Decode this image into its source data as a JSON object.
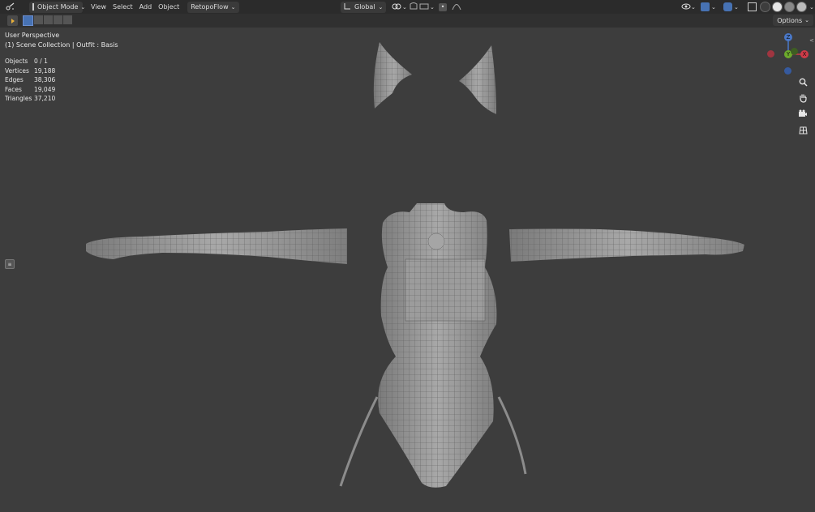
{
  "header": {
    "mode": "Object Mode",
    "menus": [
      "View",
      "Select",
      "Add",
      "Object"
    ],
    "addon": "RetopoFlow",
    "orientation": "Global"
  },
  "options_label": "Options",
  "viewport": {
    "perspective": "User Perspective",
    "collection": "(1) Scene Collection | Outfit : Basis"
  },
  "stats": [
    {
      "label": "Objects",
      "value": "0 / 1"
    },
    {
      "label": "Vertices",
      "value": "19,188"
    },
    {
      "label": "Edges",
      "value": "38,306"
    },
    {
      "label": "Faces",
      "value": "19,049"
    },
    {
      "label": "Triangles",
      "value": "37,210"
    }
  ],
  "gizmo": {
    "z": "Z",
    "x": "X",
    "y": "Y"
  },
  "colors": {
    "header": "#2b2b2b",
    "viewport": "#3d3d3d",
    "mesh": "#9a9a9a",
    "accent": "#4772b3"
  },
  "icons": [
    "editor-type-icon",
    "object-mode-icon",
    "transform-orientation-icon",
    "snap-icon",
    "proportional-icon",
    "visibility-icon",
    "gizmo-icon",
    "overlay-icon",
    "xray-icon",
    "shading-icon",
    "zoom-icon",
    "pan-hand-icon",
    "camera-icon",
    "grid-view-icon",
    "select-box-icon"
  ]
}
